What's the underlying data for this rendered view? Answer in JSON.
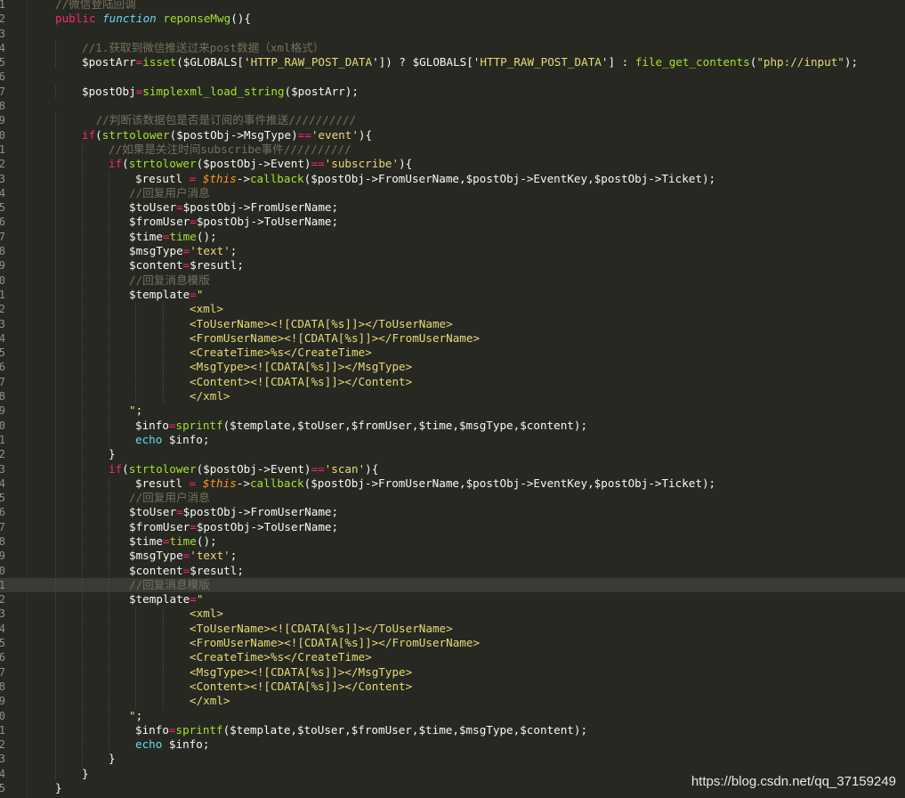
{
  "theme": {
    "background": "#272822",
    "plain": "#f8f8f2",
    "keyword": "#f92672",
    "storage": "#66d9ef",
    "function": "#a6e22e",
    "string": "#e6db74",
    "comment": "#75715e",
    "variable_this": "#fd971f"
  },
  "watermark": "https://blog.csdn.net/qq_37159249",
  "code": [
    [
      [
        "c",
        "//微信登陆回调"
      ]
    ],
    [
      [
        "k",
        "public"
      ],
      [
        "p",
        " "
      ],
      [
        "s",
        "function"
      ],
      [
        "p",
        " "
      ],
      [
        "f",
        "reponseMwg"
      ],
      [
        "p",
        "(){"
      ]
    ],
    [],
    [
      [
        "c",
        "//1.获取到微信推送过来post数据（xml格式）"
      ]
    ],
    [
      [
        "p",
        "$postArr"
      ],
      [
        "k",
        "="
      ],
      [
        "f",
        "isset"
      ],
      [
        "p",
        "($GLOBALS['"
      ],
      [
        "q",
        "HTTP_RAW_POST_DATA"
      ],
      [
        "p",
        "']) ? $GLOBALS['"
      ],
      [
        "q",
        "HTTP_RAW_POST_DATA"
      ],
      [
        "p",
        "'] : "
      ],
      [
        "f",
        "file_get_contents"
      ],
      [
        "p",
        "("
      ],
      [
        "q",
        "\"php://input\""
      ],
      [
        "p",
        ");"
      ]
    ],
    [],
    [
      [
        "p",
        "$postObj"
      ],
      [
        "k",
        "="
      ],
      [
        "f",
        "simplexml_load_string"
      ],
      [
        "p",
        "($postArr);"
      ]
    ],
    [],
    [
      [
        "c",
        " //判断该数据包是否是订阅的事件推送//////////"
      ]
    ],
    [
      [
        "k",
        "if"
      ],
      [
        "p",
        "("
      ],
      [
        "f",
        "strtolower"
      ],
      [
        "p",
        "($postObj->MsgType)"
      ],
      [
        "k",
        "=="
      ],
      [
        "q",
        "'event'"
      ],
      [
        "p",
        "){"
      ]
    ],
    [
      [
        "c",
        "//如果是关注时间subscribe事件//////////"
      ]
    ],
    [
      [
        "k",
        "if"
      ],
      [
        "p",
        "("
      ],
      [
        "f",
        "strtolower"
      ],
      [
        "p",
        "($postObj->Event)"
      ],
      [
        "k",
        "=="
      ],
      [
        "q",
        "'subscribe'"
      ],
      [
        "p",
        "){"
      ]
    ],
    [
      [
        "p",
        "$resutl "
      ],
      [
        "k",
        "="
      ],
      [
        "p",
        " "
      ],
      [
        "v",
        "$this"
      ],
      [
        "p",
        "->"
      ],
      [
        "f",
        "callback"
      ],
      [
        "p",
        "($postObj->FromUserName,$postObj->EventKey,$postObj->Ticket);"
      ]
    ],
    [
      [
        "c",
        "//回复用户消息"
      ]
    ],
    [
      [
        "p",
        "$toUser"
      ],
      [
        "k",
        "="
      ],
      [
        "p",
        "$postObj->FromUserName;"
      ]
    ],
    [
      [
        "p",
        "$fromUser"
      ],
      [
        "k",
        "="
      ],
      [
        "p",
        "$postObj->ToUserName;"
      ]
    ],
    [
      [
        "p",
        "$time"
      ],
      [
        "k",
        "="
      ],
      [
        "f",
        "time"
      ],
      [
        "p",
        "();"
      ]
    ],
    [
      [
        "p",
        "$msgType"
      ],
      [
        "k",
        "="
      ],
      [
        "q",
        "'text'"
      ],
      [
        "p",
        ";"
      ]
    ],
    [
      [
        "p",
        "$content"
      ],
      [
        "k",
        "="
      ],
      [
        "p",
        "$resutl;"
      ]
    ],
    [
      [
        "c",
        "//回复消息模版"
      ]
    ],
    [
      [
        "p",
        "$template"
      ],
      [
        "k",
        "="
      ],
      [
        "q",
        "\""
      ]
    ],
    [
      [
        "q",
        "<xml>"
      ]
    ],
    [
      [
        "q",
        "<ToUserName><![CDATA[%s]]></ToUserName>"
      ]
    ],
    [
      [
        "q",
        "<FromUserName><![CDATA[%s]]></FromUserName>"
      ]
    ],
    [
      [
        "q",
        "<CreateTime>%s</CreateTime>"
      ]
    ],
    [
      [
        "q",
        "<MsgType><![CDATA[%s]]></MsgType>"
      ]
    ],
    [
      [
        "q",
        "<Content><![CDATA[%s]]></Content>"
      ]
    ],
    [
      [
        "q",
        "</xml>"
      ]
    ],
    [
      [
        "q",
        "\""
      ],
      [
        "p",
        ";"
      ]
    ],
    [
      [
        "p",
        "$info"
      ],
      [
        "k",
        "="
      ],
      [
        "f",
        "sprintf"
      ],
      [
        "p",
        "($template,$toUser,$fromUser,$time,$msgType,$content);"
      ]
    ],
    [
      [
        "s",
        "echo"
      ],
      [
        "p",
        " $info;"
      ]
    ],
    [
      [
        "p",
        "}"
      ]
    ],
    [
      [
        "k",
        "if"
      ],
      [
        "p",
        "("
      ],
      [
        "f",
        "strtolower"
      ],
      [
        "p",
        "($postObj->Event)"
      ],
      [
        "k",
        "=="
      ],
      [
        "q",
        "'scan'"
      ],
      [
        "p",
        "){"
      ]
    ],
    [
      [
        "p",
        "$resutl "
      ],
      [
        "k",
        "="
      ],
      [
        "p",
        " "
      ],
      [
        "v",
        "$this"
      ],
      [
        "p",
        "->"
      ],
      [
        "f",
        "callback"
      ],
      [
        "p",
        "($postObj->FromUserName,$postObj->EventKey,$postObj->Ticket);"
      ]
    ],
    [
      [
        "c",
        "//回复用户消息"
      ]
    ],
    [
      [
        "p",
        "$toUser"
      ],
      [
        "k",
        "="
      ],
      [
        "p",
        "$postObj->FromUserName;"
      ]
    ],
    [
      [
        "p",
        "$fromUser"
      ],
      [
        "k",
        "="
      ],
      [
        "p",
        "$postObj->ToUserName;"
      ]
    ],
    [
      [
        "p",
        "$time"
      ],
      [
        "k",
        "="
      ],
      [
        "f",
        "time"
      ],
      [
        "p",
        "();"
      ]
    ],
    [
      [
        "p",
        "$msgType"
      ],
      [
        "k",
        "="
      ],
      [
        "q",
        "'text'"
      ],
      [
        "p",
        ";"
      ]
    ],
    [
      [
        "p",
        "$content"
      ],
      [
        "k",
        "="
      ],
      [
        "p",
        "$resutl;"
      ]
    ],
    [
      [
        "c",
        "//回复消息模版"
      ]
    ],
    [
      [
        "p",
        "$template"
      ],
      [
        "k",
        "="
      ],
      [
        "q",
        "\""
      ]
    ],
    [
      [
        "q",
        "<xml>"
      ]
    ],
    [
      [
        "q",
        "<ToUserName><![CDATA[%s]]></ToUserName>"
      ]
    ],
    [
      [
        "q",
        "<FromUserName><![CDATA[%s]]></FromUserName>"
      ]
    ],
    [
      [
        "q",
        "<CreateTime>%s</CreateTime>"
      ]
    ],
    [
      [
        "q",
        "<MsgType><![CDATA[%s]]></MsgType>"
      ]
    ],
    [
      [
        "q",
        "<Content><![CDATA[%s]]></Content>"
      ]
    ],
    [
      [
        "q",
        "</xml>"
      ]
    ],
    [
      [
        "q",
        "\""
      ],
      [
        "p",
        ";"
      ]
    ],
    [
      [
        "p",
        "$info"
      ],
      [
        "k",
        "="
      ],
      [
        "f",
        "sprintf"
      ],
      [
        "p",
        "($template,$toUser,$fromUser,$time,$msgType,$content);"
      ]
    ],
    [
      [
        "s",
        "echo"
      ],
      [
        "p",
        " $info;"
      ]
    ],
    [
      [
        "p",
        "}"
      ]
    ],
    [
      [
        "p",
        "}"
      ]
    ],
    [
      [
        "p",
        "}"
      ]
    ]
  ],
  "line_numbers": [
    "1",
    "2",
    "3",
    "4",
    "5",
    "6",
    "7",
    "8",
    "9",
    "0",
    "1",
    "2",
    "3",
    "4",
    "5",
    "6",
    "7",
    "8",
    "9",
    "0",
    "1",
    "2",
    "3",
    "4",
    "5",
    "6",
    "7",
    "8",
    "9",
    "0",
    "1",
    "2",
    "3",
    "4",
    "5",
    "6",
    "7",
    "8",
    "9",
    "0",
    "1",
    "2",
    "3",
    "4",
    "5",
    "6",
    "7",
    "8",
    "9",
    "0",
    "1",
    "2",
    "3",
    "4",
    "5"
  ]
}
